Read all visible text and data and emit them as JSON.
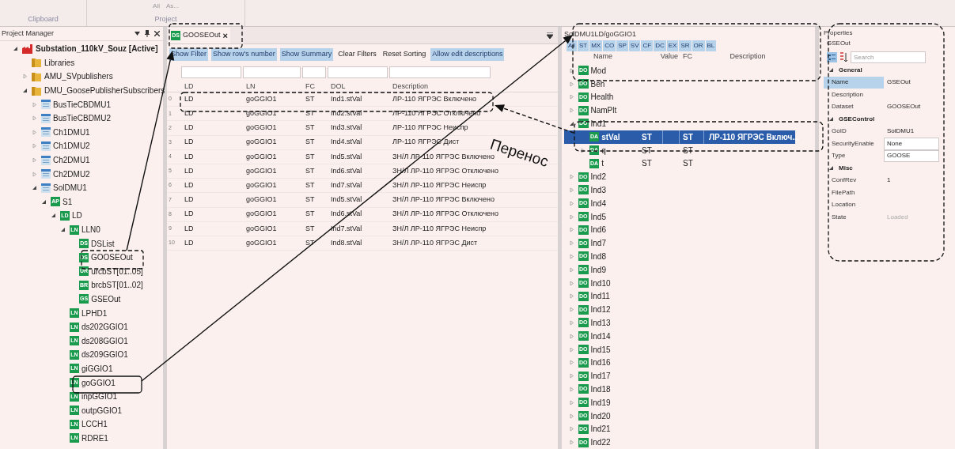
{
  "ribbon": {
    "top_items": [
      "All",
      "As..."
    ],
    "groups": [
      "Clipboard",
      "Project"
    ]
  },
  "project_manager": {
    "title": "Project Manager",
    "tree": [
      {
        "label": "Substation_110kV_Souz [Active]",
        "kind": "project",
        "expanded": true,
        "children": [
          {
            "label": "Libraries",
            "kind": "folder"
          },
          {
            "label": "AMU_SVpublishers",
            "kind": "folder",
            "expanded": false
          },
          {
            "label": "DMU_GoosePublisherSubscribers",
            "kind": "folder",
            "expanded": true,
            "children": [
              {
                "label": "BusTieCBDMU1",
                "kind": "device",
                "expanded": false
              },
              {
                "label": "BusTieCBDMU2",
                "kind": "device",
                "expanded": false
              },
              {
                "label": "Ch1DMU1",
                "kind": "device",
                "expanded": false
              },
              {
                "label": "Ch1DMU2",
                "kind": "device",
                "expanded": false
              },
              {
                "label": "Ch2DMU1",
                "kind": "device",
                "expanded": false
              },
              {
                "label": "Ch2DMU2",
                "kind": "device",
                "expanded": false
              },
              {
                "label": "SolDMU1",
                "kind": "device",
                "expanded": true,
                "children": [
                  {
                    "label": "S1",
                    "kind": "badge",
                    "badge": "AP",
                    "expanded": true,
                    "children": [
                      {
                        "label": "LD",
                        "kind": "badge",
                        "badge": "LD",
                        "expanded": true,
                        "children": [
                          {
                            "label": "LLN0",
                            "kind": "badge",
                            "badge": "LN",
                            "expanded": true,
                            "children": [
                              {
                                "label": "DSList",
                                "kind": "badge",
                                "badge": "DS"
                              },
                              {
                                "label": "GOOSEOut",
                                "kind": "badge",
                                "badge": "DS"
                              },
                              {
                                "label": "urcbST[01..05]",
                                "kind": "badge",
                                "badge": "UR"
                              },
                              {
                                "label": "brcbST[01..02]",
                                "kind": "badge",
                                "badge": "BR"
                              },
                              {
                                "label": "GSEOut",
                                "kind": "badge",
                                "badge": "GS"
                              }
                            ]
                          },
                          {
                            "label": "LPHD1",
                            "kind": "badge",
                            "badge": "LN"
                          },
                          {
                            "label": "ds202GGIO1",
                            "kind": "badge",
                            "badge": "LN"
                          },
                          {
                            "label": "ds208GGIO1",
                            "kind": "badge",
                            "badge": "LN"
                          },
                          {
                            "label": "ds209GGIO1",
                            "kind": "badge",
                            "badge": "LN"
                          },
                          {
                            "label": "giGGIO1",
                            "kind": "badge",
                            "badge": "LN"
                          },
                          {
                            "label": "goGGIO1",
                            "kind": "badge",
                            "badge": "LN"
                          },
                          {
                            "label": "inpGGIO1",
                            "kind": "badge",
                            "badge": "LN"
                          },
                          {
                            "label": "outpGGIO1",
                            "kind": "badge",
                            "badge": "LN"
                          },
                          {
                            "label": "LCCH1",
                            "kind": "badge",
                            "badge": "LN"
                          },
                          {
                            "label": "RDRE1",
                            "kind": "badge",
                            "badge": "LN"
                          }
                        ]
                      }
                    ]
                  }
                ]
              }
            ]
          }
        ]
      }
    ]
  },
  "document": {
    "tab": {
      "badge": "DS",
      "label": "GOOSEOut",
      "close": "×",
      "selected": true
    },
    "toolbar": [
      {
        "label": "Show Filter",
        "on": true
      },
      {
        "label": "Show row's number",
        "on": true
      },
      {
        "label": "Show Summary",
        "on": true
      },
      {
        "label": "Clear Filters",
        "on": false
      },
      {
        "label": "Reset Sorting",
        "on": false
      },
      {
        "label": "Allow edit descriptions",
        "on": true
      }
    ],
    "table": {
      "columns": [
        "LD",
        "LN",
        "FC",
        "DOL",
        "Description"
      ],
      "rows": [
        {
          "number": "0",
          "cells": [
            "LD",
            "goGGIO1",
            "ST",
            "Ind1.stVal",
            "ЛР-110 ЯГРЭС Включено"
          ]
        },
        {
          "number": "1",
          "cells": [
            "LD",
            "goGGIO1",
            "ST",
            "Ind2.stVal",
            "ЛР-110 ЯГРЭС Отключено"
          ]
        },
        {
          "number": "2",
          "cells": [
            "LD",
            "goGGIO1",
            "ST",
            "Ind3.stVal",
            "ЛР-110 ЯГРЭС Неиспр"
          ]
        },
        {
          "number": "3",
          "cells": [
            "LD",
            "goGGIO1",
            "ST",
            "Ind4.stVal",
            "ЛР-110 ЯГРЭС Дист"
          ]
        },
        {
          "number": "4",
          "cells": [
            "LD",
            "goGGIO1",
            "ST",
            "Ind5.stVal",
            "ЗН/Л ЛР-110 ЯГРЭС Включено"
          ]
        },
        {
          "number": "5",
          "cells": [
            "LD",
            "goGGIO1",
            "ST",
            "Ind6.stVal",
            "ЗН/Л ЛР-110 ЯГРЭС Отключено"
          ]
        },
        {
          "number": "6",
          "cells": [
            "LD",
            "goGGIO1",
            "ST",
            "Ind7.stVal",
            "ЗН/Л ЛР-110 ЯГРЭС Неиспр"
          ]
        },
        {
          "number": "7",
          "cells": [
            "LD",
            "goGGIO1",
            "ST",
            "Ind5.stVal",
            "ЗН/Л ЛР-110 ЯГРЭС Включено"
          ]
        },
        {
          "number": "8",
          "cells": [
            "LD",
            "goGGIO1",
            "ST",
            "Ind6.stVal",
            "ЗН/Л ЛР-110 ЯГРЭС Отключено"
          ]
        },
        {
          "number": "9",
          "cells": [
            "LD",
            "goGGIO1",
            "ST",
            "Ind7.stVal",
            "ЗН/Л ЛР-110 ЯГРЭС Неиспр"
          ]
        },
        {
          "number": "10",
          "cells": [
            "LD",
            "goGGIO1",
            "ST",
            "Ind8.stVal",
            "ЗН/Л ЛР-110 ЯГРЭС Дист"
          ]
        }
      ]
    }
  },
  "data_browser": {
    "path": "SolDMU1LD/goGGIO1",
    "fc_filters": [
      {
        "label": "All",
        "on": true
      },
      {
        "label": "ST",
        "on": true
      },
      {
        "label": "MX",
        "on": true
      },
      {
        "label": "CO",
        "on": true
      },
      {
        "label": "SP",
        "on": true
      },
      {
        "label": "SV",
        "on": true
      },
      {
        "label": "CF",
        "on": true
      },
      {
        "label": "DC",
        "on": true
      },
      {
        "label": "EX",
        "on": true
      },
      {
        "label": "SR",
        "on": true
      },
      {
        "label": "OR",
        "on": true
      },
      {
        "label": "BL",
        "on": true
      }
    ],
    "columns": [
      "Name",
      "Value",
      "FC",
      "Description"
    ],
    "tree": [
      {
        "name": "Mod",
        "badge": "DO",
        "expanded": false,
        "selected": false
      },
      {
        "name": "Beh",
        "badge": "DO",
        "expanded": false,
        "selected": false
      },
      {
        "name": "Health",
        "badge": "DO",
        "expanded": false,
        "selected": false
      },
      {
        "name": "NamPlt",
        "badge": "DO",
        "expanded": false,
        "selected": false
      },
      {
        "name": "Ind1",
        "badge": "DO",
        "expanded": true,
        "selected": false,
        "children": [
          {
            "name": "stVal",
            "badge": "DA",
            "cell_2": "ST",
            "fc": "ST",
            "description": "ЛР-110 ЯГРЭС Включ...",
            "selected": true
          },
          {
            "name": "q",
            "badge": "DA",
            "cell_2": "ST",
            "fc": "ST",
            "expanded": false,
            "selected": false
          },
          {
            "name": "t",
            "badge": "DA",
            "cell_2": "ST",
            "fc": "ST",
            "selected": false
          }
        ]
      },
      {
        "name": "Ind2",
        "badge": "DO",
        "expanded": false,
        "selected": false
      },
      {
        "name": "Ind3",
        "badge": "DO",
        "expanded": false,
        "selected": false
      },
      {
        "name": "Ind4",
        "badge": "DO",
        "expanded": false,
        "selected": false
      },
      {
        "name": "Ind5",
        "badge": "DO",
        "expanded": false,
        "selected": false
      },
      {
        "name": "Ind6",
        "badge": "DO",
        "expanded": false,
        "selected": false
      },
      {
        "name": "Ind7",
        "badge": "DO",
        "expanded": false,
        "selected": false
      },
      {
        "name": "Ind8",
        "badge": "DO",
        "expanded": false,
        "selected": false
      },
      {
        "name": "Ind9",
        "badge": "DO",
        "expanded": false,
        "selected": false
      },
      {
        "name": "Ind10",
        "badge": "DO",
        "expanded": false,
        "selected": false
      },
      {
        "name": "Ind11",
        "badge": "DO",
        "expanded": false,
        "selected": false
      },
      {
        "name": "Ind12",
        "badge": "DO",
        "expanded": false,
        "selected": false
      },
      {
        "name": "Ind13",
        "badge": "DO",
        "expanded": false,
        "selected": false
      },
      {
        "name": "Ind14",
        "badge": "DO",
        "expanded": false,
        "selected": false
      },
      {
        "name": "Ind15",
        "badge": "DO",
        "expanded": false,
        "selected": false
      },
      {
        "name": "Ind16",
        "badge": "DO",
        "expanded": false,
        "selected": false
      },
      {
        "name": "Ind17",
        "badge": "DO",
        "expanded": false,
        "selected": false
      },
      {
        "name": "Ind18",
        "badge": "DO",
        "expanded": false,
        "selected": false
      },
      {
        "name": "Ind19",
        "badge": "DO",
        "expanded": false,
        "selected": false
      },
      {
        "name": "Ind20",
        "badge": "DO",
        "expanded": false,
        "selected": false
      },
      {
        "name": "Ind21",
        "badge": "DO",
        "expanded": false,
        "selected": false
      },
      {
        "name": "Ind22",
        "badge": "DO",
        "expanded": false,
        "selected": false
      }
    ]
  },
  "properties": {
    "title": "Properties",
    "object": "GSEOut",
    "search": {
      "placeholder": "Search"
    },
    "categories": [
      {
        "name": "General",
        "expanded": true,
        "items": [
          {
            "name": "Name",
            "value": "GSEOut",
            "kind": "text",
            "selected": true
          },
          {
            "name": "Description",
            "kind": "text",
            "selected": false
          },
          {
            "name": "Dataset",
            "value": "GOOSEOut",
            "kind": "text",
            "selected": false
          }
        ]
      },
      {
        "name": "GSEControl",
        "expanded": true,
        "items": [
          {
            "name": "GoID",
            "value": "SolDMU1",
            "kind": "text",
            "selected": false
          },
          {
            "name": "SecurityEnable",
            "value": "None",
            "kind": "dropdown",
            "selected": false
          },
          {
            "name": "Type",
            "value": "GOOSE",
            "kind": "dropdown",
            "selected": false
          }
        ]
      },
      {
        "name": "Misc",
        "expanded": true,
        "items": [
          {
            "name": "ConfRev",
            "value": "1",
            "kind": "text",
            "selected": false
          },
          {
            "name": "FilePath",
            "kind": "text",
            "selected": false
          },
          {
            "name": "Location",
            "kind": "text",
            "selected": false
          },
          {
            "name": "State",
            "value": "Loaded",
            "kind": "text",
            "disabled": true,
            "selected": false
          }
        ]
      }
    ]
  },
  "annotation": {
    "label": "Перенос"
  }
}
